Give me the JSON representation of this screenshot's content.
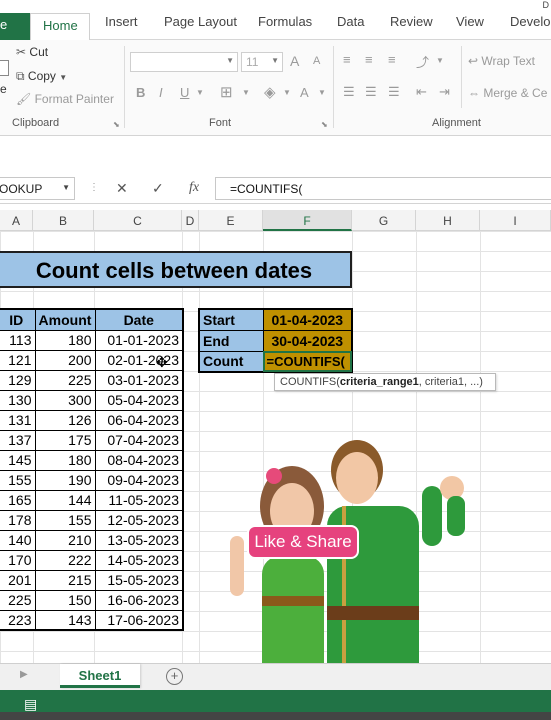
{
  "window": {
    "corner_text": "D"
  },
  "tabs": [
    "e",
    "Home",
    "Insert",
    "Page Layout",
    "Formulas",
    "Data",
    "Review",
    "View",
    "Develop"
  ],
  "ribbon": {
    "clipboard": {
      "paste_fragment": "e",
      "cut": "Cut",
      "copy": "Copy",
      "format_painter": "Format Painter",
      "label": "Clipboard"
    },
    "font": {
      "size": "11",
      "grow": "A",
      "shrink": "A",
      "bold": "B",
      "italic": "I",
      "underline": "U",
      "font_color": "A",
      "label": "Font"
    },
    "alignment": {
      "wrap_text": "Wrap Text",
      "merge_center": "Merge & Ce",
      "label": "Alignment"
    }
  },
  "formula_bar": {
    "name_box": "OOKUP",
    "cancel": "✕",
    "enter": "✓",
    "fx": "fx",
    "formula": "=COUNTIFS("
  },
  "columns": [
    "A",
    "B",
    "C",
    "D",
    "E",
    "F",
    "G",
    "H",
    "I"
  ],
  "title": "Count cells between dates",
  "table": {
    "headers": [
      "ID",
      "Amount",
      "Date"
    ],
    "rows": [
      [
        "113",
        "180",
        "01-01-2023"
      ],
      [
        "121",
        "200",
        "02-01-2023"
      ],
      [
        "129",
        "225",
        "03-01-2023"
      ],
      [
        "130",
        "300",
        "05-04-2023"
      ],
      [
        "131",
        "126",
        "06-04-2023"
      ],
      [
        "137",
        "175",
        "07-04-2023"
      ],
      [
        "145",
        "180",
        "08-04-2023"
      ],
      [
        "155",
        "190",
        "09-04-2023"
      ],
      [
        "165",
        "144",
        "11-05-2023"
      ],
      [
        "178",
        "155",
        "12-05-2023"
      ],
      [
        "140",
        "210",
        "13-05-2023"
      ],
      [
        "170",
        "222",
        "14-05-2023"
      ],
      [
        "201",
        "215",
        "15-05-2023"
      ],
      [
        "225",
        "150",
        "16-06-2023"
      ],
      [
        "223",
        "143",
        "17-06-2023"
      ]
    ]
  },
  "criteria": {
    "start_label": "Start",
    "start_value": "01-04-2023",
    "end_label": "End",
    "end_value": "30-04-2023",
    "count_label": "Count",
    "count_value": "=COUNTIFS("
  },
  "tooltip": {
    "fn": "COUNTIFS(",
    "arg1": "criteria_range1",
    "rest": ", criteria1, ...)"
  },
  "overlay": {
    "share_text": "Like & Share"
  },
  "sheets": {
    "active": "Sheet1",
    "add": "+"
  },
  "colors": {
    "excel_green": "#217346",
    "header_blue": "#9dc3e6",
    "criteria_gold": "#bf9000",
    "share_pink": "#e6427e"
  }
}
